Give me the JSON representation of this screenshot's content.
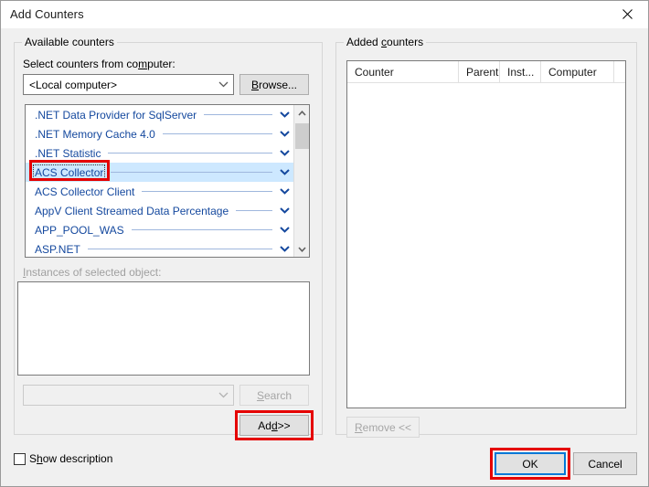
{
  "window": {
    "title": "Add Counters",
    "close_icon": "close-x-icon"
  },
  "available": {
    "group_label": "Available counters",
    "select_label_pre": "Select counters from co",
    "select_label_mn": "m",
    "select_label_post": "puter:",
    "computer_combo_value": "<Local computer>",
    "browse_mn": "B",
    "browse_post": "rowse...",
    "counters": [
      {
        "name": ".NET Data Provider for SqlServer",
        "selected": false
      },
      {
        "name": ".NET Memory Cache 4.0",
        "selected": false
      },
      {
        "name": ".NET Statistic",
        "selected": false
      },
      {
        "name": "ACS Collector",
        "selected": true
      },
      {
        "name": "ACS Collector Client",
        "selected": false
      },
      {
        "name": "AppV Client Streamed Data Percentage",
        "selected": false
      },
      {
        "name": "APP_POOL_WAS",
        "selected": false
      },
      {
        "name": "ASP.NET",
        "selected": false
      }
    ],
    "instances_label_mn": "I",
    "instances_label_post": "nstances of selected object:",
    "instances_items": [],
    "search_combo_value": "",
    "search_mn": "S",
    "search_post": "earch",
    "add_pre": "Ad",
    "add_mn": "d",
    "add_post": " >>"
  },
  "added": {
    "group_label_pre": "Added ",
    "group_label_mn": "c",
    "group_label_post": "ounters",
    "columns": [
      "Counter",
      "Parent",
      "Inst...",
      "Computer"
    ],
    "rows": [],
    "remove_mn": "R",
    "remove_post": "emove <<"
  },
  "footer": {
    "show_description_pre": "S",
    "show_description_mn": "h",
    "show_description_post": "ow description",
    "show_description_checked": false,
    "ok_label": "OK",
    "cancel_label": "Cancel"
  },
  "colors": {
    "annotation_red": "#e50000",
    "focus_blue": "#0078d7",
    "counter_link": "#14489e",
    "selection_blue": "#cde8ff",
    "dialog_bg": "#f0f0f0"
  },
  "scrollbar": {
    "up_icon": "chevron-up-icon",
    "down_icon": "chevron-down-icon"
  }
}
